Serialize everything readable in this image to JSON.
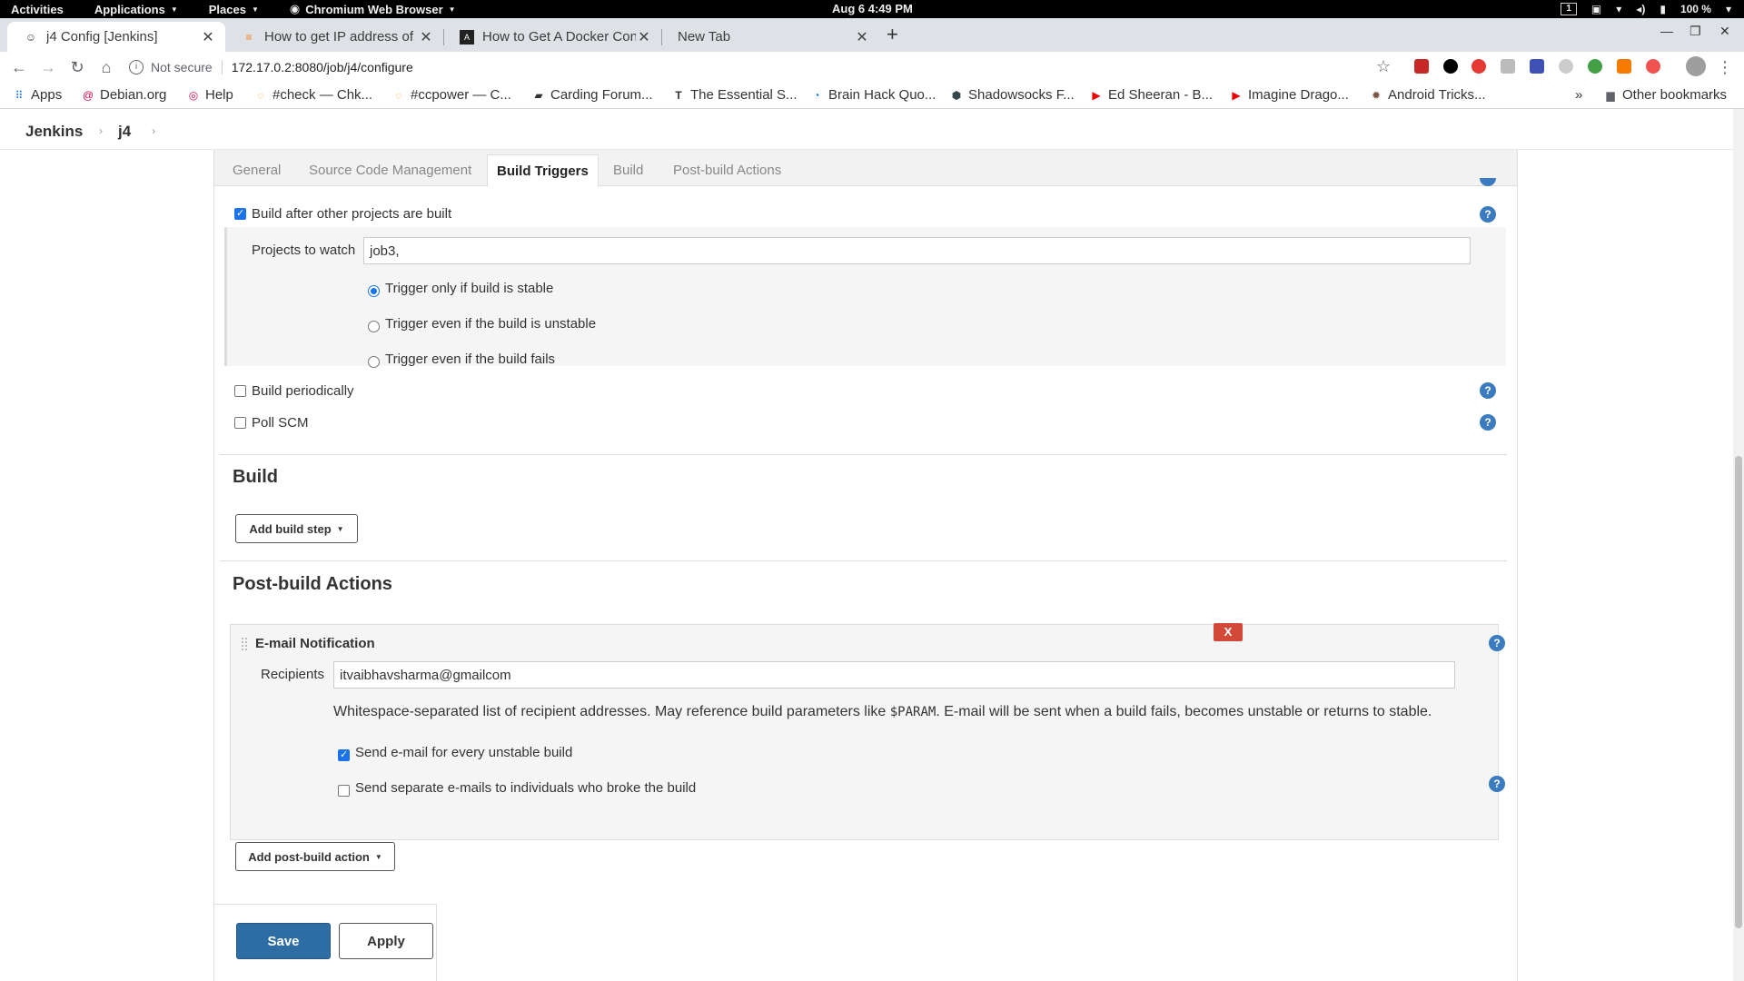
{
  "system_bar": {
    "activities": "Activities",
    "applications": "Applications",
    "places": "Places",
    "active_app": "Chromium Web Browser",
    "clock": "Aug 6  4:49 PM",
    "workspace": "1",
    "battery": "100 %"
  },
  "browser": {
    "tabs": [
      {
        "title": "j4 Config [Jenkins]",
        "active": true,
        "icon": "jenkins-icon"
      },
      {
        "title": "How to get IP address of r",
        "active": false,
        "icon": "stackoverflow-icon"
      },
      {
        "title": "How to Get A Docker Cont",
        "active": false,
        "icon": "site-icon"
      },
      {
        "title": "New Tab",
        "active": false,
        "icon": ""
      }
    ],
    "address": {
      "security_label": "Not secure",
      "url": "172.17.0.2:8080/job/j4/configure"
    },
    "bookmarks": [
      {
        "label": "Apps",
        "icon": "apps-grid-icon"
      },
      {
        "label": "Debian.org",
        "icon": "debian-icon"
      },
      {
        "label": "Help",
        "icon": "help-icon"
      },
      {
        "label": "#check — Chk...",
        "icon": "site-icon"
      },
      {
        "label": "#ccpower — C...",
        "icon": "site-icon"
      },
      {
        "label": "Carding Forum...",
        "icon": "site-icon"
      },
      {
        "label": "The Essential S...",
        "icon": "site-icon"
      },
      {
        "label": "Brain Hack Quo...",
        "icon": "site-icon"
      },
      {
        "label": "Shadowsocks F...",
        "icon": "site-icon"
      },
      {
        "label": "Ed Sheeran - B...",
        "icon": "youtube-icon"
      },
      {
        "label": "Imagine Drago...",
        "icon": "youtube-icon"
      },
      {
        "label": "Android Tricks...",
        "icon": "site-icon"
      }
    ],
    "more_bookmarks": "»",
    "other_bookmarks": "Other bookmarks"
  },
  "jenkins": {
    "breadcrumb": [
      "Jenkins",
      "j4"
    ],
    "config_tabs": [
      "General",
      "Source Code Management",
      "Build Triggers",
      "Build",
      "Post-build Actions"
    ],
    "active_tab": "Build Triggers",
    "triggers": {
      "build_after_label": "Build after other projects are built",
      "projects_to_watch_label": "Projects to watch",
      "projects_to_watch_value": "job3,",
      "radio_stable": "Trigger only if build is stable",
      "radio_unstable": "Trigger even if the build is unstable",
      "radio_fails": "Trigger even if the build fails",
      "build_periodically_label": "Build periodically",
      "poll_scm_label": "Poll SCM"
    },
    "build": {
      "title": "Build",
      "add_step_label": "Add build step"
    },
    "post_build": {
      "title": "Post-build Actions",
      "email_title": "E-mail Notification",
      "remove_label": "X",
      "recipients_label": "Recipients",
      "recipients_value": "itvaibhavsharma@gmailcom",
      "desc_part1": "Whitespace-separated list of recipient addresses. May reference build parameters like ",
      "desc_param": "$PARAM",
      "desc_part2": ". E-mail will be sent when a build fails, becomes unstable or returns to stable.",
      "unstable_label": "Send e-mail for every unstable build",
      "separate_label": "Send separate e-mails to individuals who broke the build",
      "add_action_label": "Add post-build action"
    },
    "save_label": "Save",
    "apply_label": "Apply",
    "help_glyph": "?"
  },
  "colors": {
    "primary_button": "#2e6da4",
    "help_icon": "#3b7bbf",
    "delete_button": "#d24939",
    "checkbox_checked": "#1a73e8"
  }
}
